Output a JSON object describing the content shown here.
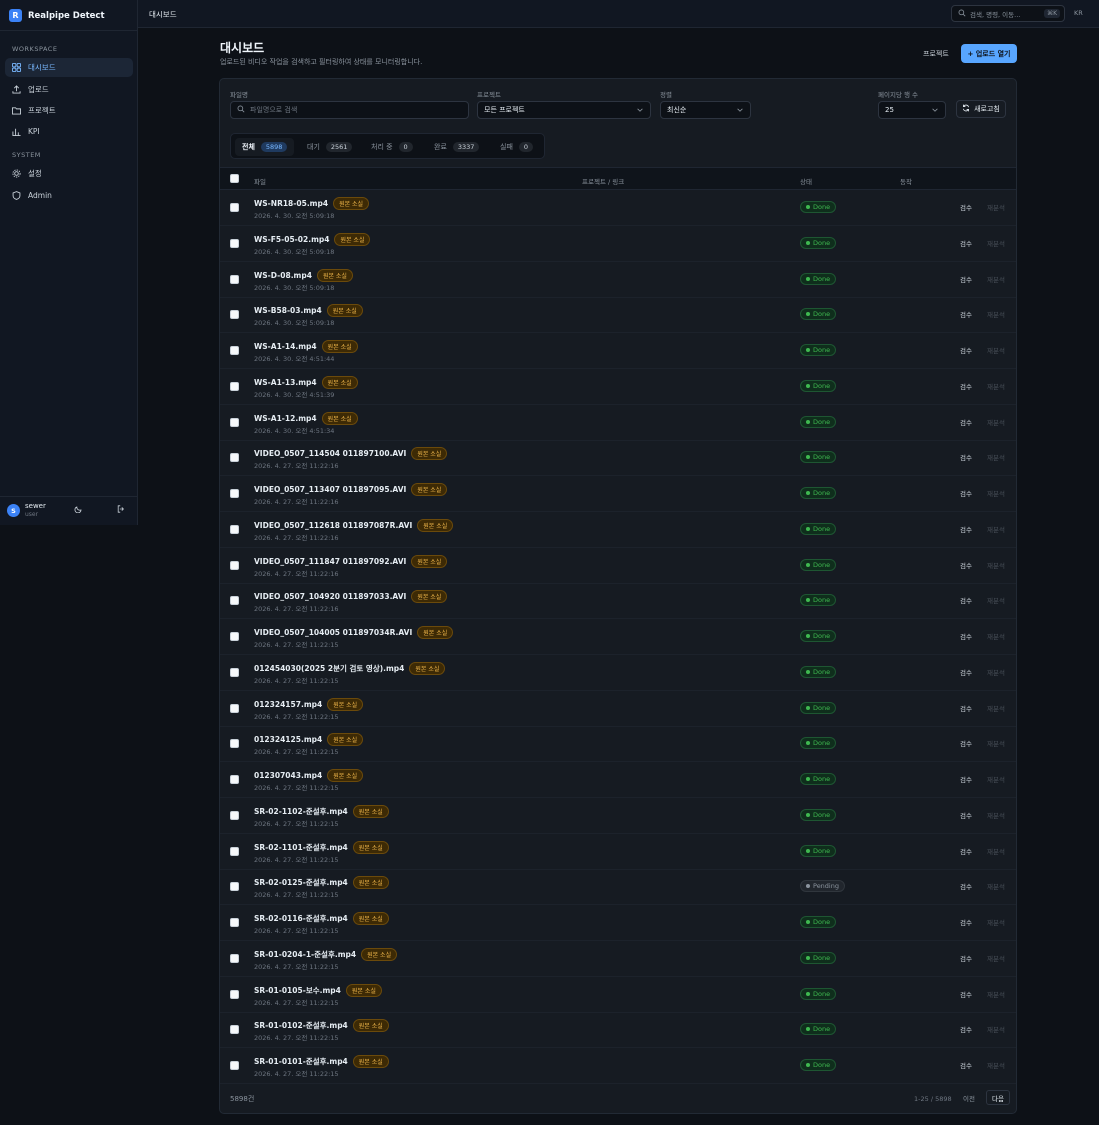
{
  "app": {
    "name": "Realpipe Detect",
    "logo_letter": "R"
  },
  "sidebar": {
    "workspace_label": "WORKSPACE",
    "system_label": "SYSTEM",
    "items": [
      {
        "label": "대시보드",
        "icon": "dashboard-icon"
      },
      {
        "label": "업로드",
        "icon": "upload-icon"
      },
      {
        "label": "프로젝트",
        "icon": "folder-icon"
      },
      {
        "label": "KPI",
        "icon": "bar-chart-icon"
      },
      {
        "label": "설정",
        "icon": "gear-icon"
      },
      {
        "label": "Admin",
        "icon": "shield-icon"
      }
    ],
    "user": {
      "initial": "S",
      "name": "sewer",
      "role": "user"
    }
  },
  "topbar": {
    "breadcrumb": "대시보드",
    "search_placeholder": "검색, 명령, 이동...",
    "shortcut": "⌘K",
    "lang": "KR"
  },
  "header": {
    "title": "대시보드",
    "subtitle": "업로드된 비디오 작업을 검색하고 필터링하여 상태를 모니터링합니다.",
    "project_button": "프로젝트",
    "upload_button": "+ 업로드 열기"
  },
  "filters": {
    "filename_label": "파일명",
    "filename_placeholder": "파일명으로 검색",
    "project_label": "프로젝트",
    "project_value": "모든 프로젝트",
    "sort_label": "정렬",
    "sort_value": "최신순",
    "per_page_label": "페이지당 행 수",
    "per_page_value": "25",
    "refresh_button": "새로고침"
  },
  "tabs": [
    {
      "label": "전체",
      "count": "5898"
    },
    {
      "label": "대기",
      "count": "2561"
    },
    {
      "label": "처리 중",
      "count": "0"
    },
    {
      "label": "완료",
      "count": "3337"
    },
    {
      "label": "실패",
      "count": "0"
    }
  ],
  "table": {
    "columns": {
      "file": "파일",
      "project": "프로젝트 / 링크",
      "status": "상태",
      "action": "동작"
    },
    "tag_label": "원본 소실",
    "review_label": "검수",
    "reanalyze_label": "재분석",
    "rows": [
      {
        "name": "WS-NR18-05.mp4",
        "time": "2026. 4. 30. 오전 5:09:18",
        "status": "Done"
      },
      {
        "name": "WS-F5-05-02.mp4",
        "time": "2026. 4. 30. 오전 5:09:18",
        "status": "Done"
      },
      {
        "name": "WS-D-08.mp4",
        "time": "2026. 4. 30. 오전 5:09:18",
        "status": "Done"
      },
      {
        "name": "WS-B58-03.mp4",
        "time": "2026. 4. 30. 오전 5:09:18",
        "status": "Done"
      },
      {
        "name": "WS-A1-14.mp4",
        "time": "2026. 4. 30. 오전 4:51:44",
        "status": "Done"
      },
      {
        "name": "WS-A1-13.mp4",
        "time": "2026. 4. 30. 오전 4:51:39",
        "status": "Done"
      },
      {
        "name": "WS-A1-12.mp4",
        "time": "2026. 4. 30. 오전 4:51:34",
        "status": "Done"
      },
      {
        "name": "VIDEO_0507_114504 011897100.AVI",
        "time": "2026. 4. 27. 오전 11:22:16",
        "status": "Done"
      },
      {
        "name": "VIDEO_0507_113407 011897095.AVI",
        "time": "2026. 4. 27. 오전 11:22:16",
        "status": "Done"
      },
      {
        "name": "VIDEO_0507_112618 011897087R.AVI",
        "time": "2026. 4. 27. 오전 11:22:16",
        "status": "Done"
      },
      {
        "name": "VIDEO_0507_111847 011897092.AVI",
        "time": "2026. 4. 27. 오전 11:22:16",
        "status": "Done"
      },
      {
        "name": "VIDEO_0507_104920 011897033.AVI",
        "time": "2026. 4. 27. 오전 11:22:16",
        "status": "Done"
      },
      {
        "name": "VIDEO_0507_104005 011897034R.AVI",
        "time": "2026. 4. 27. 오전 11:22:15",
        "status": "Done"
      },
      {
        "name": "012454030(2025 2분기 검토 영상).mp4",
        "time": "2026. 4. 27. 오전 11:22:15",
        "status": "Done"
      },
      {
        "name": "012324157.mp4",
        "time": "2026. 4. 27. 오전 11:22:15",
        "status": "Done"
      },
      {
        "name": "012324125.mp4",
        "time": "2026. 4. 27. 오전 11:22:15",
        "status": "Done"
      },
      {
        "name": "012307043.mp4",
        "time": "2026. 4. 27. 오전 11:22:15",
        "status": "Done"
      },
      {
        "name": "SR-02-1102-준설후.mp4",
        "time": "2026. 4. 27. 오전 11:22:15",
        "status": "Done"
      },
      {
        "name": "SR-02-1101-준설후.mp4",
        "time": "2026. 4. 27. 오전 11:22:15",
        "status": "Done"
      },
      {
        "name": "SR-02-0125-준설후.mp4",
        "time": "2026. 4. 27. 오전 11:22:15",
        "status": "Pending"
      },
      {
        "name": "SR-02-0116-준설후.mp4",
        "time": "2026. 4. 27. 오전 11:22:15",
        "status": "Done"
      },
      {
        "name": "SR-01-0204-1-준설후.mp4",
        "time": "2026. 4. 27. 오전 11:22:15",
        "status": "Done"
      },
      {
        "name": "SR-01-0105-보수.mp4",
        "time": "2026. 4. 27. 오전 11:22:15",
        "status": "Done"
      },
      {
        "name": "SR-01-0102-준설후.mp4",
        "time": "2026. 4. 27. 오전 11:22:15",
        "status": "Done"
      },
      {
        "name": "SR-01-0101-준설후.mp4",
        "time": "2026. 4. 27. 오전 11:22:15",
        "status": "Done"
      }
    ]
  },
  "footer": {
    "total": "5898건",
    "range": "1-25 / 5898",
    "prev": "이전",
    "next": "다음"
  },
  "colors": {
    "accent": "#58a6ff",
    "done": "#3fb950",
    "tag": "#f2b84b",
    "background": "#0d1117"
  }
}
